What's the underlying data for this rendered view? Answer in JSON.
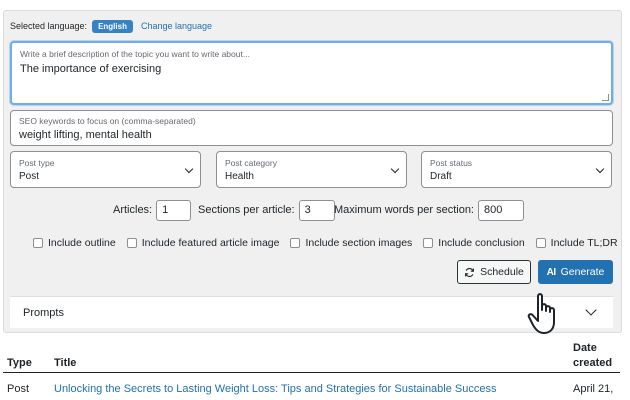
{
  "language": {
    "label": "Selected language:",
    "current": "English",
    "change_link": "Change language"
  },
  "description": {
    "label": "Write a brief description of the topic you want to write about...",
    "value": "The importance of exercising"
  },
  "seo": {
    "label": "SEO keywords to focus on (comma-separated)",
    "value": "weight lifting, mental health"
  },
  "selects": {
    "post_type": {
      "label": "Post type",
      "value": "Post"
    },
    "post_category": {
      "label": "Post category",
      "value": "Health"
    },
    "post_status": {
      "label": "Post status",
      "value": "Draft"
    }
  },
  "numbers": {
    "articles_label": "Articles:",
    "articles_value": "1",
    "sections_label": "Sections per article:",
    "sections_value": "3",
    "words_label": "Maximum words per section:",
    "words_value": "800"
  },
  "checkboxes": [
    {
      "label": "Include outline"
    },
    {
      "label": "Include featured article image"
    },
    {
      "label": "Include section images"
    },
    {
      "label": "Include conclusion"
    },
    {
      "label": "Include TL;DR"
    }
  ],
  "buttons": {
    "schedule": "Schedule",
    "generate": "Generate",
    "generate_badge": "AI"
  },
  "prompts": {
    "label": "Prompts"
  },
  "table": {
    "headers": {
      "type": "Type",
      "title": "Title",
      "date_line1": "Date",
      "date_line2": "created"
    },
    "rows": [
      {
        "type": "Post",
        "title": "Unlocking the Secrets to Lasting Weight Loss: Tips and Strategies for Sustainable Success",
        "date": "April 21,"
      }
    ]
  },
  "colors": {
    "primary": "#2271b1",
    "badge": "#3582c4",
    "panel_bg": "#f0f0f1",
    "focus_border": "#72aee6"
  },
  "icons": {
    "schedule": "refresh-icon",
    "cursor": "hand-pointer-icon"
  }
}
